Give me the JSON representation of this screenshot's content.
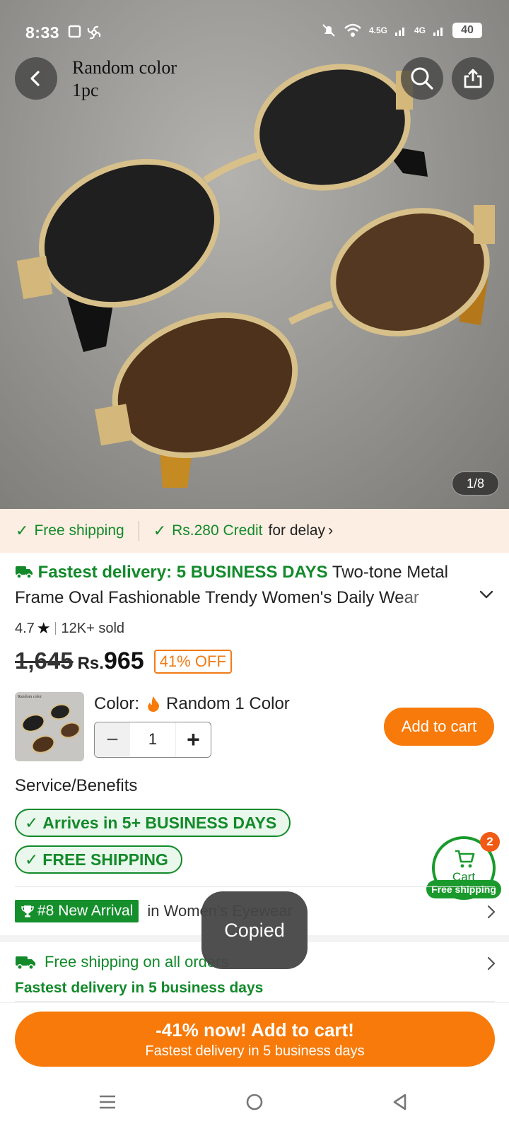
{
  "status_bar": {
    "time": "8:33",
    "net1": "4.5G",
    "net2": "4G",
    "battery": "40"
  },
  "hero": {
    "caption_line1": "Random color",
    "caption_line2": "1pc",
    "image_counter": "1/8",
    "icons": [
      "back-arrow-icon",
      "search-icon",
      "share-icon"
    ]
  },
  "shipping_banner": {
    "free_shipping": "Free shipping",
    "credit": "Rs.280 Credit",
    "credit_suffix": "for delay",
    "chevron": "›"
  },
  "product": {
    "fastest_delivery": "Fastest delivery: 5 BUSINESS DAYS",
    "title": "Two-tone Metal Frame Oval Fashionable Trendy Women's Daily Wear",
    "rating": "4.7",
    "sold": "12K+ sold",
    "old_price": "1,645",
    "currency": "Rs.",
    "price": "965",
    "discount": "41% OFF"
  },
  "variant": {
    "color_label": "Color:",
    "color_value": "Random 1 Color",
    "quantity": "1",
    "minus": "−",
    "plus": "+",
    "add_to_cart": "Add to cart",
    "thumb_caption": "Random color"
  },
  "service": {
    "title": "Service/Benefits",
    "badge1": "Arrives in 5+ BUSINESS DAYS",
    "badge2": "FREE SHIPPING"
  },
  "floating_cart": {
    "label": "Cart",
    "count": "2",
    "free_shipping": "Free shipping"
  },
  "ranking": {
    "badge": "#8 New Arrival",
    "category": "in Women's Eyewear"
  },
  "shipping_info": {
    "line1": "Free shipping on all orders",
    "line2": "Fastest delivery in 5 business days"
  },
  "toast": "Copied",
  "cta": {
    "line1": "-41% now! Add to cart!",
    "line2": "Fastest delivery in 5 business days"
  },
  "colors": {
    "brand_orange": "#f77a0a",
    "success_green": "#128a2a",
    "banner_bg": "#fdeee3"
  }
}
